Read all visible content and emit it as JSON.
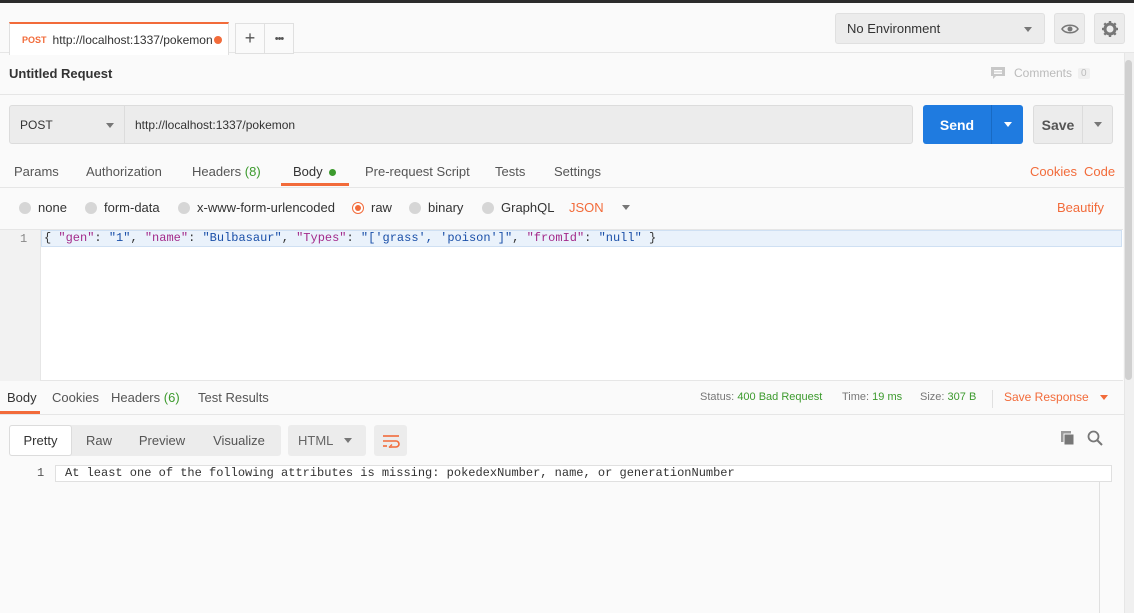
{
  "tabbar": {
    "tab_method": "POST",
    "tab_url": "http://localhost:1337/pokemon",
    "add_tab": "+",
    "more_tabs": "•••"
  },
  "environment": {
    "selected": "No Environment"
  },
  "request": {
    "title": "Untitled Request",
    "comments_label": "Comments",
    "comments_count": "0",
    "method": "POST",
    "url": "http://localhost:1337/pokemon",
    "send_label": "Send",
    "save_label": "Save"
  },
  "request_tabs": [
    {
      "label": "Params"
    },
    {
      "label": "Authorization"
    },
    {
      "label": "Headers",
      "count": "(8)"
    },
    {
      "label": "Body"
    },
    {
      "label": "Pre-request Script"
    },
    {
      "label": "Tests"
    },
    {
      "label": "Settings"
    }
  ],
  "links": {
    "cookies": "Cookies",
    "code": "Code",
    "beautify": "Beautify"
  },
  "body_modes": [
    "none",
    "form-data",
    "x-www-form-urlencoded",
    "raw",
    "binary",
    "GraphQL"
  ],
  "body_format": "JSON",
  "editor": {
    "line_number": "1",
    "tokens": [
      {
        "t": "{ ",
        "c": "#333"
      },
      {
        "t": "\"gen\"",
        "c": "#a32a8a"
      },
      {
        "t": ": ",
        "c": "#333"
      },
      {
        "t": "\"1\"",
        "c": "#1a4fa8"
      },
      {
        "t": ", ",
        "c": "#333"
      },
      {
        "t": "\"name\"",
        "c": "#a32a8a"
      },
      {
        "t": ": ",
        "c": "#333"
      },
      {
        "t": "\"Bulbasaur\"",
        "c": "#1a4fa8"
      },
      {
        "t": ", ",
        "c": "#333"
      },
      {
        "t": "\"Types\"",
        "c": "#a32a8a"
      },
      {
        "t": ": ",
        "c": "#333"
      },
      {
        "t": "\"['grass', 'poison']\"",
        "c": "#1a4fa8"
      },
      {
        "t": ", ",
        "c": "#333"
      },
      {
        "t": "\"fromId\"",
        "c": "#a32a8a"
      },
      {
        "t": ": ",
        "c": "#333"
      },
      {
        "t": "\"null\"",
        "c": "#1a4fa8"
      },
      {
        "t": " }",
        "c": "#333"
      }
    ]
  },
  "response_tabs": [
    {
      "label": "Body"
    },
    {
      "label": "Cookies"
    },
    {
      "label": "Headers",
      "count": "(6)"
    },
    {
      "label": "Test Results"
    }
  ],
  "response_status": {
    "status_label": "Status:",
    "status_value": "400 Bad Request",
    "time_label": "Time:",
    "time_value": "19 ms",
    "size_label": "Size:",
    "size_value": "307 B",
    "save_response": "Save Response"
  },
  "response_view": {
    "modes": [
      "Pretty",
      "Raw",
      "Preview",
      "Visualize"
    ],
    "format": "HTML",
    "line_number": "1",
    "text": "At least one of the following attributes is missing: pokedexNumber, name, or generationNumber"
  },
  "colors": {
    "accent": "#f26b3a",
    "send": "#1f7be0",
    "status_ok_text": "#3c9a2d"
  }
}
